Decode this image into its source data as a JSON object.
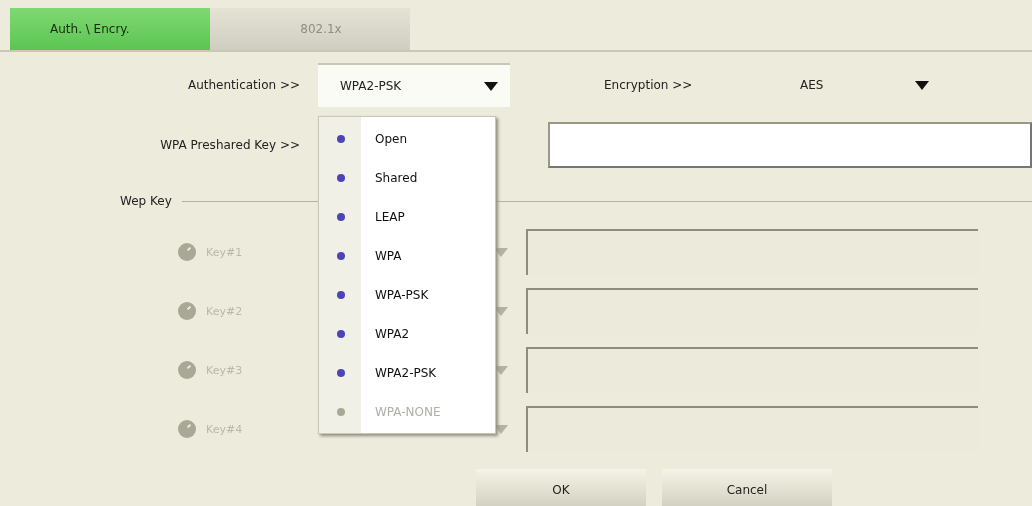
{
  "tabs": [
    {
      "label": "Auth. \\ Encry.",
      "selected": true
    },
    {
      "label": "802.1x",
      "selected": false
    }
  ],
  "authentication": {
    "label": "Authentication >>",
    "value": "WPA2-PSK",
    "expanded": true,
    "options": [
      {
        "label": "Open",
        "disabled": false
      },
      {
        "label": "Shared",
        "disabled": false
      },
      {
        "label": "LEAP",
        "disabled": false
      },
      {
        "label": "WPA",
        "disabled": false
      },
      {
        "label": "WPA-PSK",
        "disabled": false
      },
      {
        "label": "WPA2",
        "disabled": false
      },
      {
        "label": "WPA2-PSK",
        "disabled": false
      },
      {
        "label": "WPA-NONE",
        "disabled": true
      }
    ]
  },
  "encryption": {
    "label": "Encryption >>",
    "value": "AES"
  },
  "preshared_key": {
    "label": "WPA Preshared Key >>"
  },
  "wep_key": {
    "label": "Wep Key",
    "keys": [
      {
        "label": "Key#1",
        "disabled": true
      },
      {
        "label": "Key#2",
        "disabled": true
      },
      {
        "label": "Key#3",
        "disabled": true
      },
      {
        "label": "Key#4",
        "disabled": true
      }
    ]
  },
  "buttons": [
    "OK",
    "Cancel"
  ]
}
